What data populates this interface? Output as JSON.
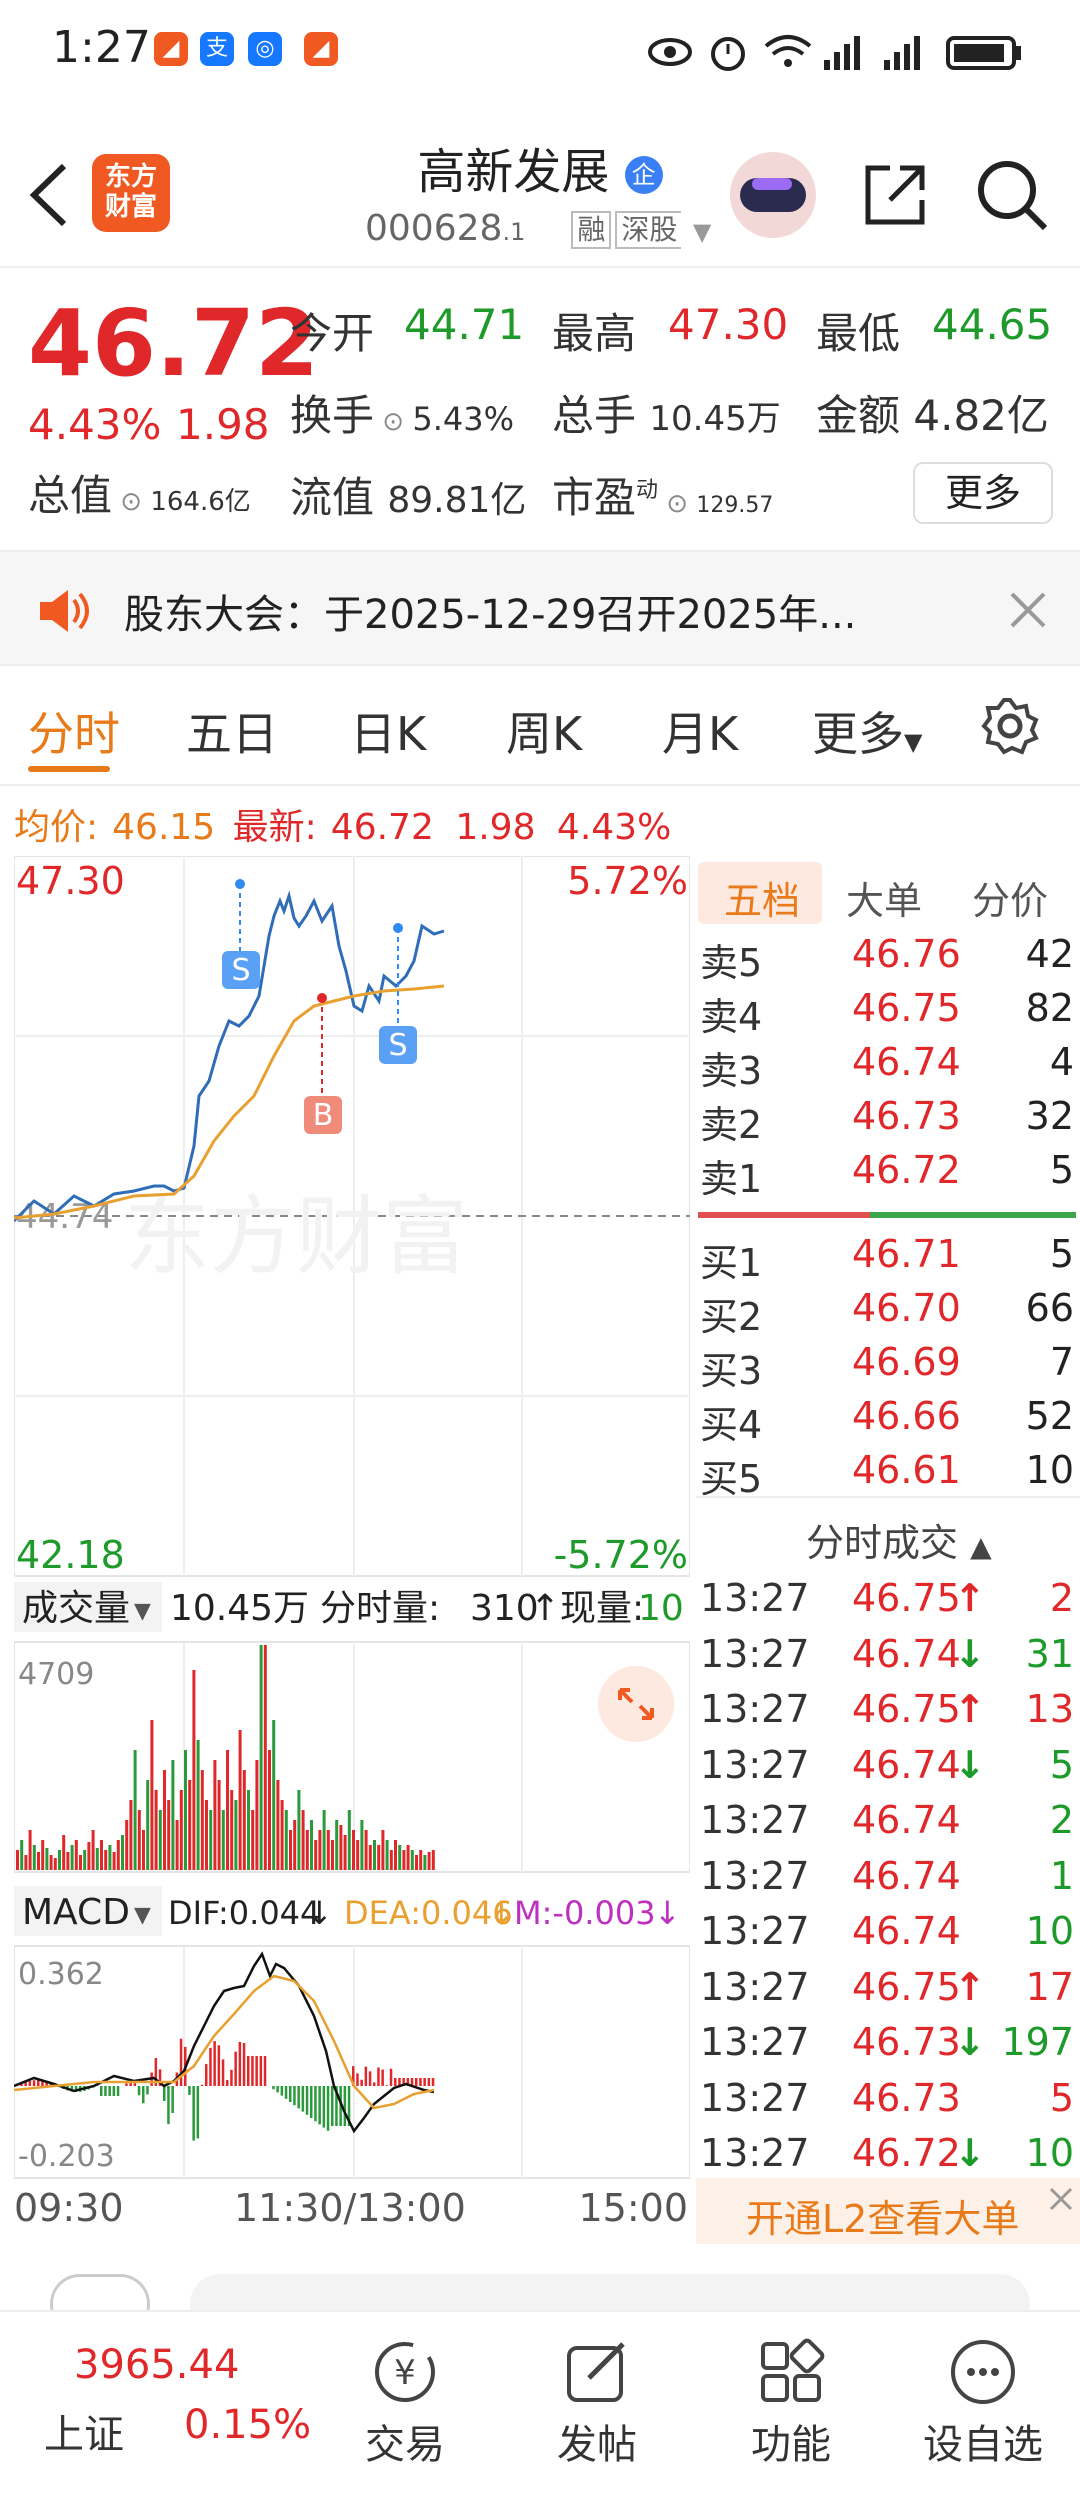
{
  "status": {
    "time": "1:27"
  },
  "header": {
    "logo": "东方\n财富",
    "title": "高新发展",
    "code": "000628",
    "suffix": ".1",
    "tags": [
      "融",
      "深股"
    ],
    "cert": "企"
  },
  "quote": {
    "price": "46.72",
    "pct": "4.43%",
    "change": "1.98",
    "open_label": "今开",
    "open": "44.71",
    "high_label": "最高",
    "high": "47.30",
    "low_label": "最低",
    "low": "44.65",
    "turnover_label": "换手",
    "turnover": "5.43%",
    "volume_label": "总手",
    "volume": "10.45万",
    "amount_label": "金额",
    "amount": "4.82亿",
    "mktcap_label": "总值",
    "mktcap": "164.6亿",
    "float_label": "流值",
    "float": "89.81亿",
    "pe_label": "市盈",
    "pe_sup": "动",
    "pe": "129.57",
    "more": "更多"
  },
  "notice": {
    "text": "股东大会：于2025-12-29召开2025年..."
  },
  "tabs": [
    "分时",
    "五日",
    "日K",
    "周K",
    "月K",
    "更多"
  ],
  "summary": {
    "avg_label": "均价:",
    "avg": "46.15",
    "latest_label": "最新:",
    "latest": "46.72",
    "change": "1.98",
    "pct": "4.43%"
  },
  "chart": {
    "watermark": "东方财富",
    "ymax": "47.30",
    "ymin": "42.18",
    "pmax": "5.72%",
    "pmin": "-5.72%",
    "base": "44.74",
    "vol_label": "成交量",
    "vol_total": "10.45万",
    "vol_interval_label": "分时量:",
    "vol_interval": "310",
    "vol_now_label": "现量:",
    "vol_now": "10",
    "vol_max": "4709",
    "macd_label": "MACD",
    "dif": "DIF:0.044",
    "dea": "DEA:0.046",
    "m": "M:-0.003",
    "macd_max": "0.362",
    "macd_min": "-0.203",
    "t_start": "09:30",
    "t_mid": "11:30/13:00",
    "t_end": "15:00",
    "markers": [
      "S",
      "B",
      "S"
    ]
  },
  "orderbook": {
    "tabs": [
      "五档",
      "大单",
      "分价"
    ],
    "asks": [
      {
        "l": "卖5",
        "p": "46.76",
        "v": "42"
      },
      {
        "l": "卖4",
        "p": "46.75",
        "v": "82"
      },
      {
        "l": "卖3",
        "p": "46.74",
        "v": "4"
      },
      {
        "l": "卖2",
        "p": "46.73",
        "v": "32"
      },
      {
        "l": "卖1",
        "p": "46.72",
        "v": "5"
      }
    ],
    "bids": [
      {
        "l": "买1",
        "p": "46.71",
        "v": "5"
      },
      {
        "l": "买2",
        "p": "46.70",
        "v": "66"
      },
      {
        "l": "买3",
        "p": "46.69",
        "v": "7"
      },
      {
        "l": "买4",
        "p": "46.66",
        "v": "52"
      },
      {
        "l": "买5",
        "p": "46.61",
        "v": "10"
      }
    ]
  },
  "trades": {
    "title": "分时成交",
    "rows": [
      {
        "t": "13:27",
        "p": "46.75",
        "d": "↑",
        "v": "2",
        "c": "red"
      },
      {
        "t": "13:27",
        "p": "46.74",
        "d": "↓",
        "v": "31",
        "c": "green"
      },
      {
        "t": "13:27",
        "p": "46.75",
        "d": "↑",
        "v": "13",
        "c": "red"
      },
      {
        "t": "13:27",
        "p": "46.74",
        "d": "↓",
        "v": "5",
        "c": "green"
      },
      {
        "t": "13:27",
        "p": "46.74",
        "d": "",
        "v": "2",
        "c": "green"
      },
      {
        "t": "13:27",
        "p": "46.74",
        "d": "",
        "v": "1",
        "c": "green"
      },
      {
        "t": "13:27",
        "p": "46.74",
        "d": "",
        "v": "10",
        "c": "green"
      },
      {
        "t": "13:27",
        "p": "46.75",
        "d": "↑",
        "v": "17",
        "c": "red"
      },
      {
        "t": "13:27",
        "p": "46.73",
        "d": "↓",
        "v": "197",
        "c": "green"
      },
      {
        "t": "13:27",
        "p": "46.73",
        "d": "",
        "v": "5",
        "c": "red"
      },
      {
        "t": "13:27",
        "p": "46.72",
        "d": "↓",
        "v": "10",
        "c": "green"
      }
    ],
    "l2": "开通L2查看大单"
  },
  "bottom": {
    "index_value": "3965.44",
    "index_name": "上证",
    "index_pct": "0.15%",
    "items": [
      "交易",
      "发帖",
      "功能",
      "设自选"
    ]
  }
}
